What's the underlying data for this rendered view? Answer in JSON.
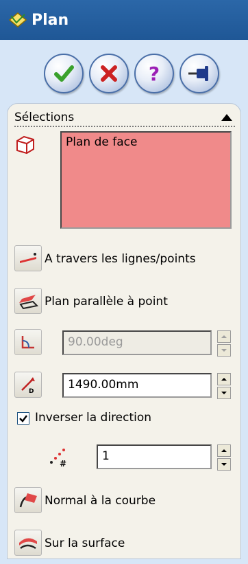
{
  "title_bar": {
    "title": "Plan",
    "icon": "plane-icon"
  },
  "actions": [
    {
      "name": "ok-button",
      "icon": "check-icon",
      "color": "#3aa12c"
    },
    {
      "name": "cancel-button",
      "icon": "close-icon",
      "color": "#cc2222"
    },
    {
      "name": "help-button",
      "icon": "question-icon",
      "color": "#9b1fb5"
    },
    {
      "name": "pin-button",
      "icon": "pushpin-icon",
      "color": "#1f3a8a"
    }
  ],
  "selections": {
    "header": "Sélections",
    "reference_value": "Plan de face",
    "selection_box_color": "#f08a8a"
  },
  "options": {
    "through_lines": "A travers les lignes/points",
    "parallel_plane": "Plan parallèle à point",
    "angle_value": "90.00deg",
    "distance_value": "1490.00mm",
    "flip_direction": "Inverser la direction",
    "flip_checked": true,
    "instances_value": "1",
    "normal_to_curve": "Normal à la courbe",
    "on_surface": "Sur la surface"
  }
}
